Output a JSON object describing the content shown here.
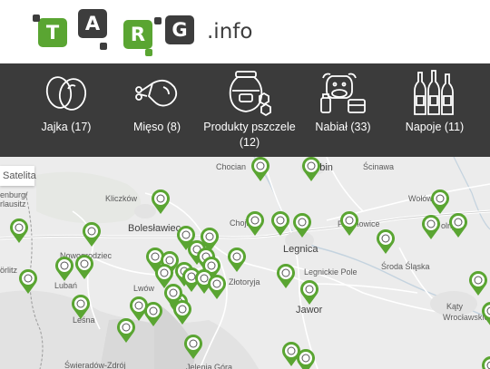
{
  "header": {
    "logo_letters": [
      "T",
      "A",
      "R",
      "G"
    ],
    "logo_suffix": ".info"
  },
  "categories": [
    {
      "label": "Jajka (17)",
      "icon": "eggs-icon"
    },
    {
      "label": "Mięso (8)",
      "icon": "meat-icon"
    },
    {
      "label": "Produkty pszczele (12)",
      "icon": "honey-icon"
    },
    {
      "label": "Nabiał (33)",
      "icon": "dairy-icon"
    },
    {
      "label": "Napoje (11)",
      "icon": "drinks-icon"
    }
  ],
  "map": {
    "satellite_label": "Satelita",
    "places": [
      {
        "name": "Chocian",
        "big": false
      },
      {
        "name": "Lubin",
        "big": true
      },
      {
        "name": "Ścinawa",
        "big": false
      },
      {
        "name": "Kliczków",
        "big": false
      },
      {
        "name": "Wołów",
        "big": false
      },
      {
        "name": "enburg/",
        "big": false
      },
      {
        "name": "rlausitz",
        "big": false
      },
      {
        "name": "Bolesławiec",
        "big": true
      },
      {
        "name": "Chojnów",
        "big": false
      },
      {
        "name": "Prochowice",
        "big": false
      },
      {
        "name": "olny",
        "big": false
      },
      {
        "name": "Nowogrodziec",
        "big": false
      },
      {
        "name": "Legnica",
        "big": true
      },
      {
        "name": "Środa Śląska",
        "big": false
      },
      {
        "name": "örlitz",
        "big": false
      },
      {
        "name": "Legnickie Pole",
        "big": false
      },
      {
        "name": "Lubań",
        "big": false
      },
      {
        "name": "Lwów",
        "big": false
      },
      {
        "name": "Złotoryja",
        "big": false
      },
      {
        "name": "Jawor",
        "big": true
      },
      {
        "name": "Kąty",
        "big": false
      },
      {
        "name": "Wrocławskie",
        "big": false
      },
      {
        "name": "Leśna",
        "big": false
      },
      {
        "name": "Świeradów-Zdrój",
        "big": false
      },
      {
        "name": "Jelenia Góra",
        "big": false
      }
    ],
    "accent_color": "#5aa532",
    "pin_count": 44
  }
}
